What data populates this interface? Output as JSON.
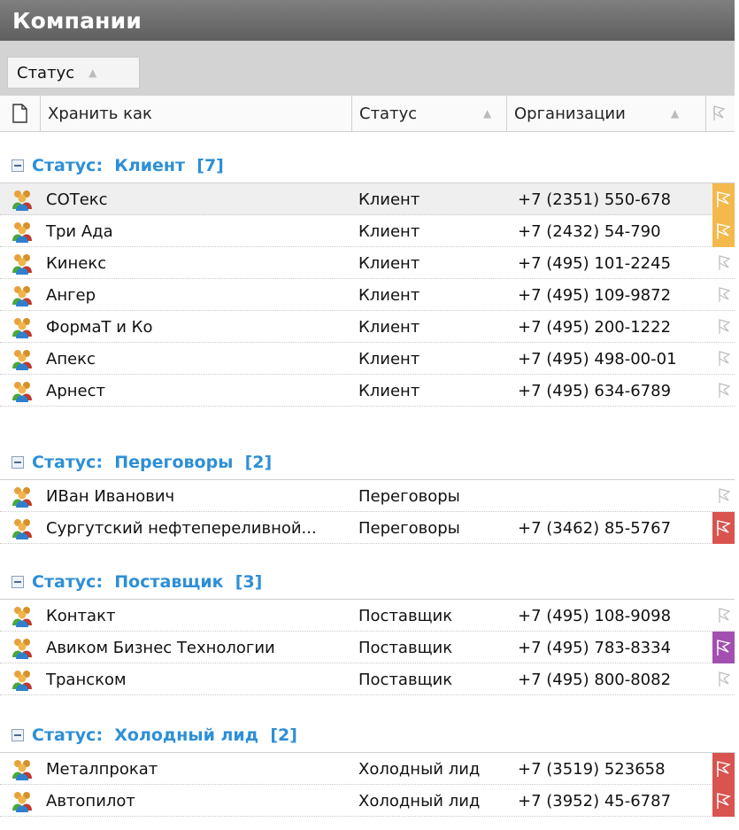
{
  "title": "Компании",
  "group_panel": {
    "chip_label": "Статус"
  },
  "columns": {
    "save_as": "Хранить как",
    "status": "Статус",
    "organizations": "Организации"
  },
  "groups": [
    {
      "label": "Статус:  Клиент  [7]",
      "rows": [
        {
          "name": "СОТекс",
          "status": "Клиент",
          "phone": "+7 (2351) 550-678",
          "flag": "#f3b94c",
          "selected": true
        },
        {
          "name": "Три Ада",
          "status": "Клиент",
          "phone": "+7 (2432) 54-790",
          "flag": "#f3b94c"
        },
        {
          "name": "Кинекс",
          "status": "Клиент",
          "phone": "+7 (495) 101-2245",
          "flag": "none"
        },
        {
          "name": "Ангер",
          "status": "Клиент",
          "phone": "+7 (495) 109-9872",
          "flag": "none"
        },
        {
          "name": "ФормаТ и Ко",
          "status": "Клиент",
          "phone": "+7 (495) 200-1222",
          "flag": "none"
        },
        {
          "name": "Апекс",
          "status": "Клиент",
          "phone": "+7 (495) 498-00-01",
          "flag": "none"
        },
        {
          "name": "Арнест",
          "status": "Клиент",
          "phone": "+7 (495) 634-6789",
          "flag": "none"
        }
      ]
    },
    {
      "label": "Статус:  Переговоры  [2]",
      "rows": [
        {
          "name": "ИВан Иванович",
          "status": "Переговоры",
          "phone": "",
          "flag": "none"
        },
        {
          "name": "Сургутский нефтепереливной...",
          "status": "Переговоры",
          "phone": "+7 (3462) 85-5767",
          "flag": "#d9534f"
        }
      ]
    },
    {
      "label": "Статус:  Поставщик  [3]",
      "rows": [
        {
          "name": "Контакт",
          "status": "Поставщик",
          "phone": "+7 (495) 108-9098",
          "flag": "none"
        },
        {
          "name": "Авиком Бизнес Технологии",
          "status": "Поставщик",
          "phone": "+7 (495) 783-8334",
          "flag": "#a24fb0"
        },
        {
          "name": "Транском",
          "status": "Поставщик",
          "phone": "+7 (495) 800-8082",
          "flag": "none"
        }
      ]
    },
    {
      "label": "Статус:  Холодный лид  [2]",
      "rows": [
        {
          "name": "Металпрокат",
          "status": "Холодный лид",
          "phone": "+7 (3519) 523658",
          "flag": "#d9534f"
        },
        {
          "name": "Автопилот",
          "status": "Холодный лид",
          "phone": "+7 (3952) 45-6787",
          "flag": "#d9534f"
        }
      ]
    }
  ],
  "icons": {
    "new_document": "new-document-icon",
    "company": "company-people-icon",
    "flag": "flag-icon"
  }
}
